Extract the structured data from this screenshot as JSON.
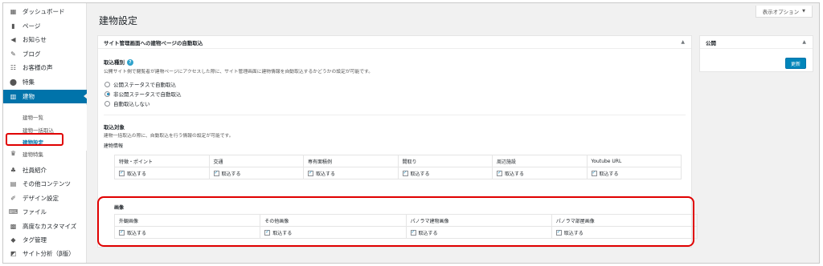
{
  "sidebar": {
    "items": [
      {
        "label": "ダッシュボード",
        "icon": "dashboard-icon",
        "glyph": "▦"
      },
      {
        "label": "ページ",
        "icon": "page-icon",
        "glyph": "▮"
      },
      {
        "label": "お知らせ",
        "icon": "megaphone-icon",
        "glyph": "◀"
      },
      {
        "label": "ブログ",
        "icon": "pencil-icon",
        "glyph": "✎"
      },
      {
        "label": "お客様の声",
        "icon": "groups-icon",
        "glyph": "☷"
      },
      {
        "label": "特集",
        "icon": "pin-icon",
        "glyph": "⬤"
      },
      {
        "label": "建物",
        "icon": "building-icon",
        "glyph": "▥"
      }
    ],
    "submenu": [
      "建物一覧",
      "建物一括取込",
      "建物設定"
    ],
    "minor_item": {
      "label": "建物特集",
      "glyph": "♛"
    },
    "items_after": [
      {
        "label": "社員紹介",
        "icon": "sitemap-icon",
        "glyph": "♣"
      },
      {
        "label": "その他コンテンツ",
        "icon": "document-icon",
        "glyph": "▤"
      },
      {
        "label": "デザイン設定",
        "icon": "paint-icon",
        "glyph": "✐"
      },
      {
        "label": "ファイル",
        "icon": "folder-icon",
        "glyph": "⌨"
      },
      {
        "label": "高度なカスタマイズ",
        "icon": "code-icon",
        "glyph": "▩"
      },
      {
        "label": "タグ管理",
        "icon": "tag-icon",
        "glyph": "◆"
      },
      {
        "label": "サイト分析（β版）",
        "icon": "chart-icon",
        "glyph": "◩"
      }
    ]
  },
  "header": {
    "title": "建物設定",
    "screen_options": "表示オプション",
    "screen_options_arrow": "▼"
  },
  "main_box": {
    "title": "サイト管理画面への建物ページの自動取込",
    "toggle": "▲",
    "import_type": {
      "title": "取込種別",
      "help": "?",
      "desc": "公開サイト側で閲覧者が建物ページにアクセスした際に、サイト管理画面に建物情報を自動取込するかどうかの設定が可能です。",
      "options": [
        "公開ステータスで自動取込",
        "非公開ステータスで自動取込",
        "自動取込しない"
      ],
      "selected": 1
    },
    "import_target": {
      "title": "取込対象",
      "desc": "建物一括取込の際に、自動取込を行う情報の設定が可能です。",
      "building_info_label": "建物情報",
      "columns": [
        "特徴・ポイント",
        "交通",
        "専有面積例",
        "間取り",
        "周辺施設",
        "Youtube URL"
      ],
      "checkbox_label": "取込する"
    },
    "images": {
      "label": "画像",
      "columns": [
        "外観画像",
        "その他画像",
        "パノラマ建物画像",
        "パノラマ部屋画像"
      ],
      "checkbox_label": "取込する"
    }
  },
  "publish_box": {
    "title": "公開",
    "toggle": "▲",
    "button": "更新"
  },
  "colors": {
    "accent": "#0073aa",
    "highlight": "#e00000",
    "button": "#0085ba"
  }
}
